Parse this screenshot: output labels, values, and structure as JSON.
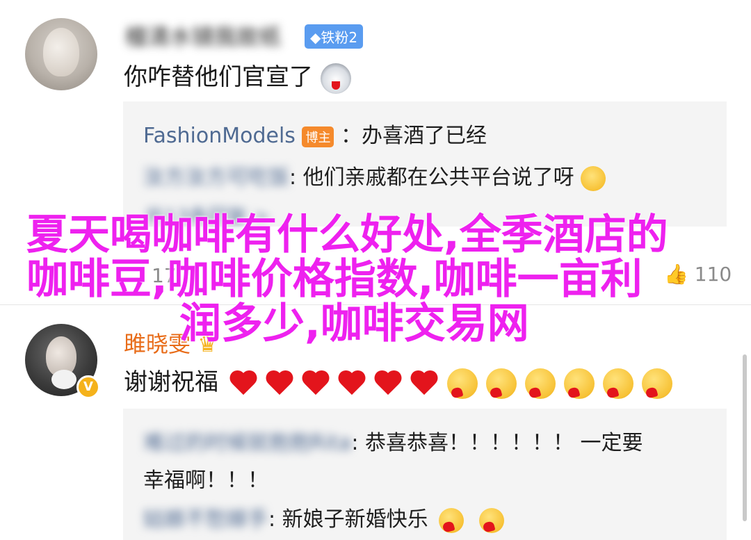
{
  "comment1": {
    "user_name": "檀清水镜我故纸",
    "badge": "铁粉2",
    "text": "你咋替他们官宣了",
    "emoji": "husky-face",
    "replies": [
      {
        "name": "FashionModels",
        "badge": "博主",
        "text": "：办喜酒了已经"
      },
      {
        "name": "汝方汝方可吃饭",
        "text": ": 他们亲戚都在公共平台说了呀",
        "emoji": "laughing-tears"
      }
    ],
    "more_replies": "共13条回复 >"
  },
  "stats": {
    "left": "17",
    "like_count": "110"
  },
  "comment2": {
    "user_name": "雎晓雯",
    "text": "谢谢祝福",
    "hearts": 6,
    "smileys": 6,
    "replies": [
      {
        "name": "难过的时候就抱抱Rita",
        "text": ": 恭喜恭喜！！！！！！ 一定要",
        "text_line2": "幸福啊！！！"
      },
      {
        "name": "姑娘不愁嫁手",
        "text": ": 新娘子新婚快乐",
        "emoji_count": 2
      }
    ]
  },
  "overlay": {
    "line1": "夏天喝咖啡有什么好处,全季酒店的",
    "line2": "咖啡豆,咖啡价格指数,咖啡一亩利",
    "line3": "润多少,咖啡交易网"
  },
  "colors": {
    "overlay": "#ee21ef",
    "link": "#4f6a92",
    "reply_bg": "#f4f4f4",
    "badge_blue": "#5a9cf0",
    "badge_orange": "#f58a2c",
    "username_orange": "#e86c19"
  }
}
